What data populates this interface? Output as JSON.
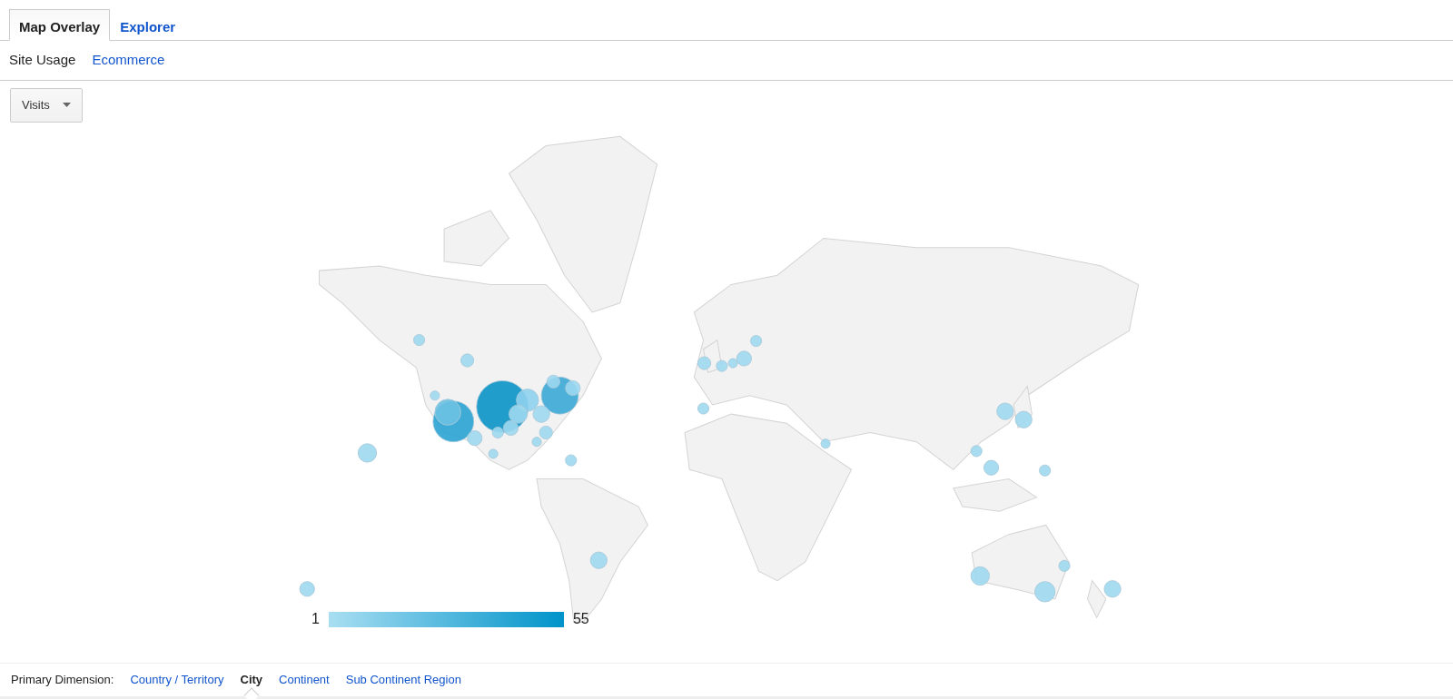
{
  "tabs": [
    {
      "label": "Map Overlay",
      "selected": true
    },
    {
      "label": "Explorer",
      "selected": false
    }
  ],
  "subtabs": [
    {
      "label": "Site Usage",
      "selected": true
    },
    {
      "label": "Ecommerce",
      "selected": false
    }
  ],
  "metric_dropdown": {
    "label": "Visits"
  },
  "map": {
    "legend": {
      "min": "1",
      "max": "55"
    }
  },
  "primary_dimension": {
    "label": "Primary Dimension:",
    "options": [
      {
        "label": "Country / Territory",
        "selected": false
      },
      {
        "label": "City",
        "selected": true
      },
      {
        "label": "Continent",
        "selected": false
      },
      {
        "label": "Sub Continent Region",
        "selected": false
      }
    ]
  }
}
